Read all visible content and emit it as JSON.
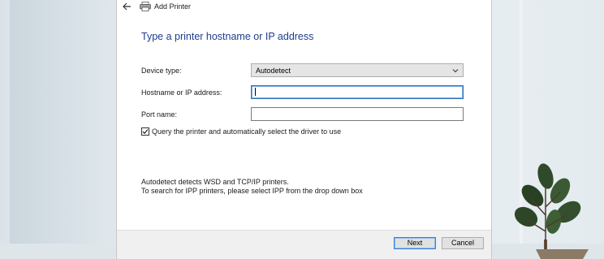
{
  "window": {
    "title": "Add Printer",
    "back_icon": "back-arrow-icon",
    "app_icon": "printer-icon"
  },
  "form": {
    "heading": "Type a printer hostname or IP address",
    "device_type_label": "Device type:",
    "device_type_value": "Autodetect",
    "hostname_label": "Hostname or IP address:",
    "hostname_value": "",
    "port_label": "Port name:",
    "port_value": "",
    "query_checkbox_label": "Query the printer and automatically select the driver to use",
    "query_checked": true,
    "info_line1": "Autodetect detects WSD and TCP/IP printers.",
    "info_line2": "To search for IPP printers, please select IPP from the drop down box"
  },
  "footer": {
    "next_label": "Next",
    "cancel_label": "Cancel"
  },
  "colors": {
    "heading": "#1f3c8f",
    "focus_border": "#2f6fb5",
    "dialog_bg": "#ffffff",
    "footer_bg": "#f0f0f0"
  }
}
